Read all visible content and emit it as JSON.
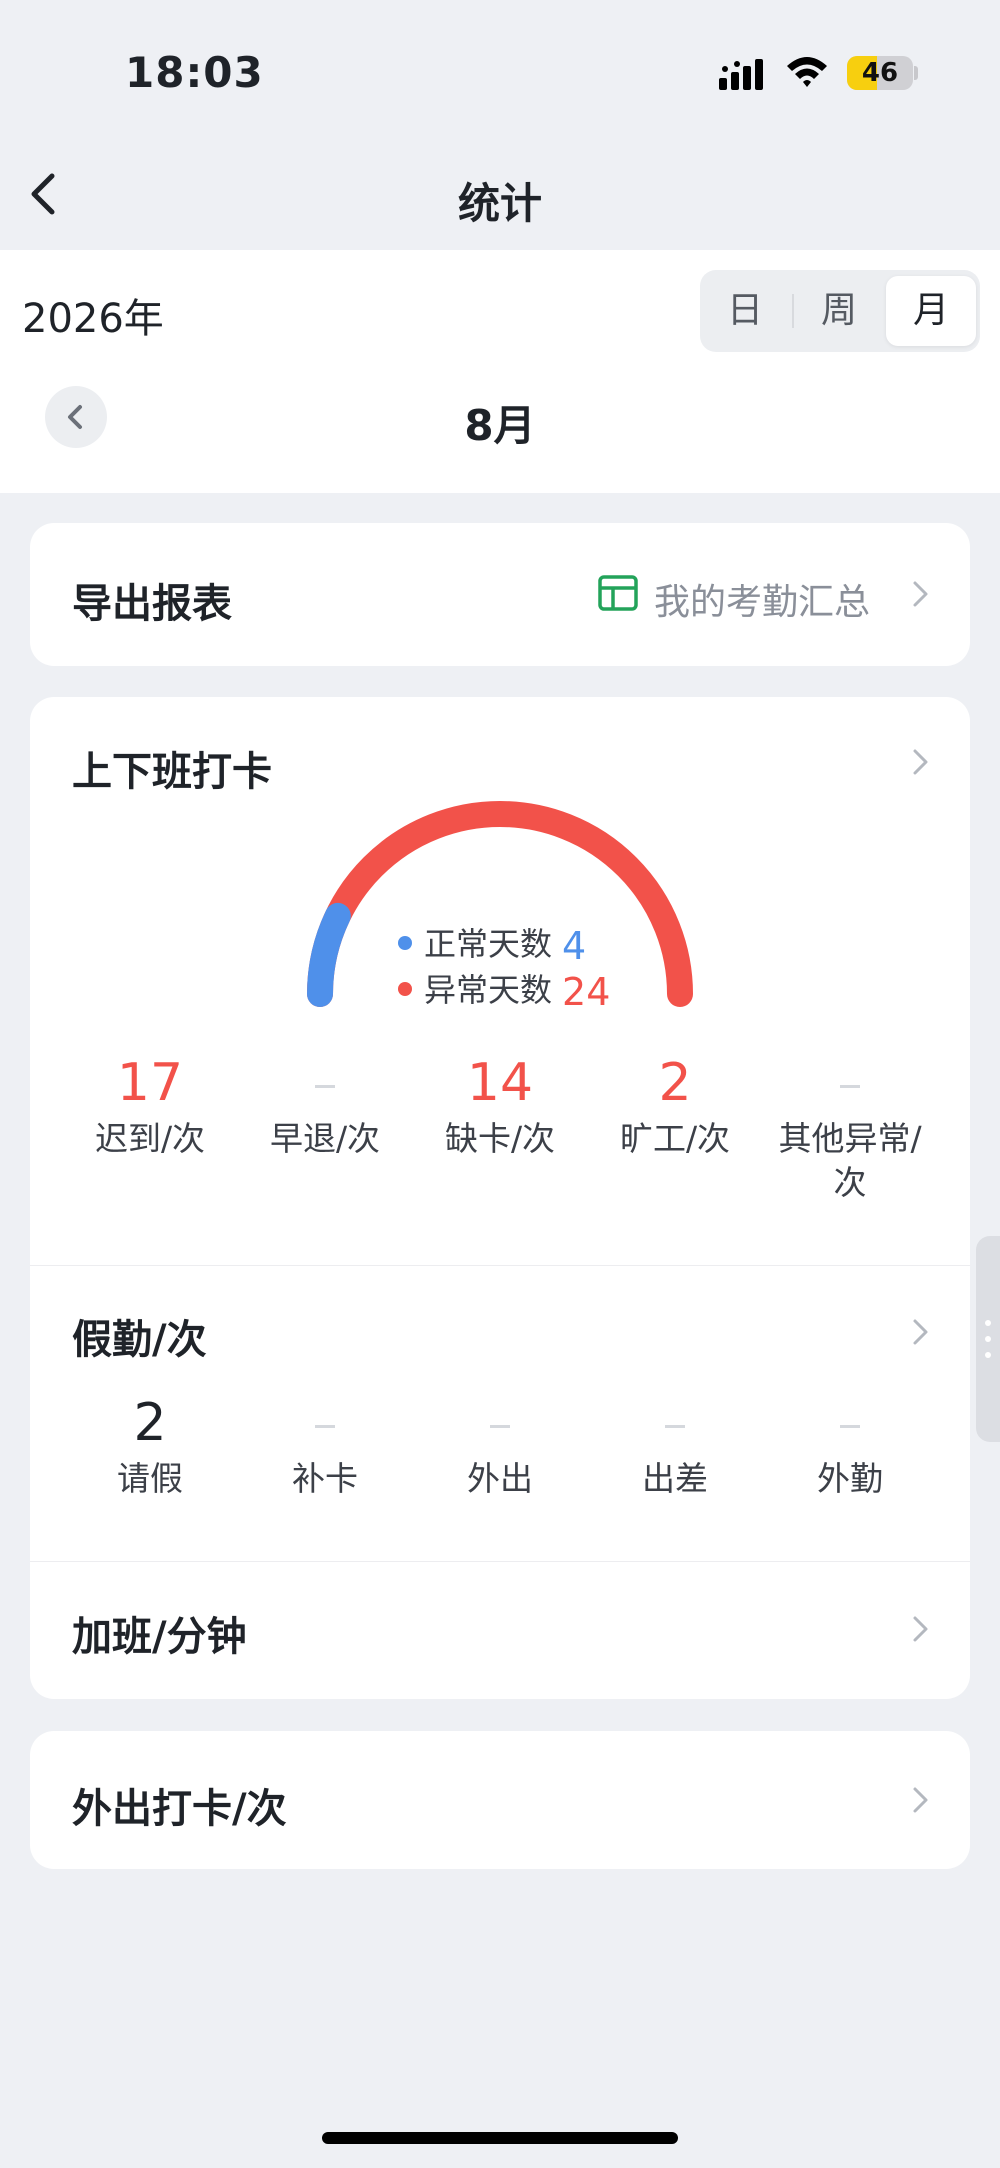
{
  "status_bar": {
    "time": "18:03",
    "battery": "46",
    "battery_level": 0.46
  },
  "nav": {
    "title": "统计"
  },
  "date_bar": {
    "year": "2026年",
    "modes": [
      "日",
      "周",
      "月"
    ],
    "active_mode": "月",
    "month": "8月"
  },
  "export": {
    "label": "导出报表",
    "link": "我的考勤汇总"
  },
  "clock": {
    "title": "上下班打卡",
    "normal_label": "正常天数",
    "normal_value": "4",
    "abnormal_label": "异常天数",
    "abnormal_value": "24",
    "colors": {
      "normal": "#4f90ea",
      "abnormal": "#f2524a"
    },
    "stats": [
      {
        "value": "17",
        "label": "迟到/次"
      },
      {
        "value": "",
        "label": "早退/次"
      },
      {
        "value": "14",
        "label": "缺卡/次"
      },
      {
        "value": "2",
        "label": "旷工/次"
      },
      {
        "value": "",
        "label": "其他异常/次"
      }
    ]
  },
  "leave": {
    "title": "假勤/次",
    "stats": [
      {
        "value": "2",
        "label": "请假"
      },
      {
        "value": "",
        "label": "补卡"
      },
      {
        "value": "",
        "label": "外出"
      },
      {
        "value": "",
        "label": "出差"
      },
      {
        "value": "",
        "label": "外勤"
      }
    ]
  },
  "overtime": {
    "title": "加班/分钟"
  },
  "outing": {
    "title": "外出打卡/次"
  }
}
